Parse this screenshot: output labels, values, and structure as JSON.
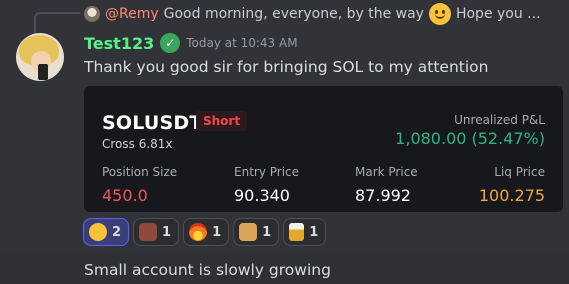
{
  "reply": {
    "author": "@Remy",
    "text": "Good morning, everyone, by the way",
    "emoji": "slightly-smiling-face-icon",
    "tail": "Hope you ..."
  },
  "author": {
    "name": "Test123",
    "verified_icon": "verified-check-icon",
    "timestamp": "Today at 10:43 AM",
    "name_color": "#57f287"
  },
  "message": {
    "text": "Thank you good sir for bringing SOL to my attention"
  },
  "trade_card": {
    "symbol": "SOLUSDT",
    "side": "Short",
    "leverage": "Cross 6.81x",
    "pnl_label": "Unrealized P&L",
    "pnl_value": "1,080.00 (52.47%)",
    "columns": [
      {
        "label": "Position Size",
        "value": "450.0",
        "color": "#f0565a"
      },
      {
        "label": "Entry Price",
        "value": "90.340",
        "color": "#ffffff"
      },
      {
        "label": "Mark Price",
        "value": "87.992",
        "color": "#ffffff"
      },
      {
        "label": "Liq Price",
        "value": "100.275",
        "color": "#f0a73a"
      }
    ]
  },
  "reactions": [
    {
      "icon": "money-mouth-face-icon",
      "count": "2",
      "active": true
    },
    {
      "icon": "custom-emote-icon",
      "count": "1",
      "active": false
    },
    {
      "icon": "fire-icon",
      "count": "1",
      "active": false
    },
    {
      "icon": "custom-emote-icon",
      "count": "1",
      "active": false
    },
    {
      "icon": "beer-mug-icon",
      "count": "1",
      "active": false
    }
  ],
  "next_message": {
    "text": "Small account is slowly growing"
  }
}
